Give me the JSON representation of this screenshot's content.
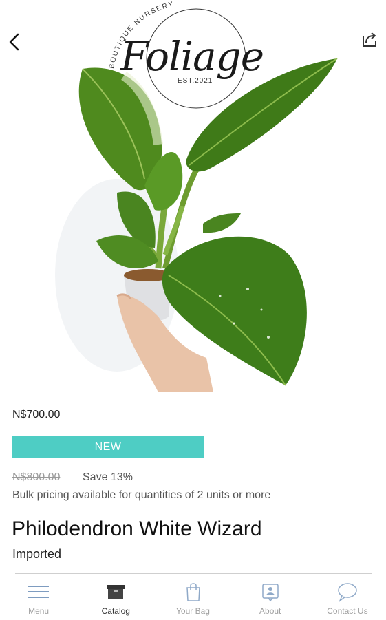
{
  "logo": {
    "arc_text": "BOUTIQUE NURSERY",
    "name": "Foliage",
    "est": "EST.2021"
  },
  "icons": {
    "back": "back-arrow-icon",
    "share": "share-icon"
  },
  "product": {
    "price": "N$700.00",
    "badge": "NEW",
    "old_price": "N$800.00",
    "save": "Save 13%",
    "bulk": "Bulk pricing available for quantities of 2 units or more",
    "title": "Philodendron White Wizard",
    "subtitle": "Imported"
  },
  "colors": {
    "badge": "#4ecdc4",
    "nav_inactive": "#a0a0a0",
    "nav_active": "#333333"
  },
  "nav": {
    "items": [
      {
        "label": "Menu",
        "icon": "menu-icon"
      },
      {
        "label": "Catalog",
        "icon": "catalog-box-icon",
        "active": true
      },
      {
        "label": "Your Bag",
        "icon": "bag-icon"
      },
      {
        "label": "About",
        "icon": "about-icon"
      },
      {
        "label": "Contact Us",
        "icon": "chat-bubble-icon"
      }
    ]
  }
}
